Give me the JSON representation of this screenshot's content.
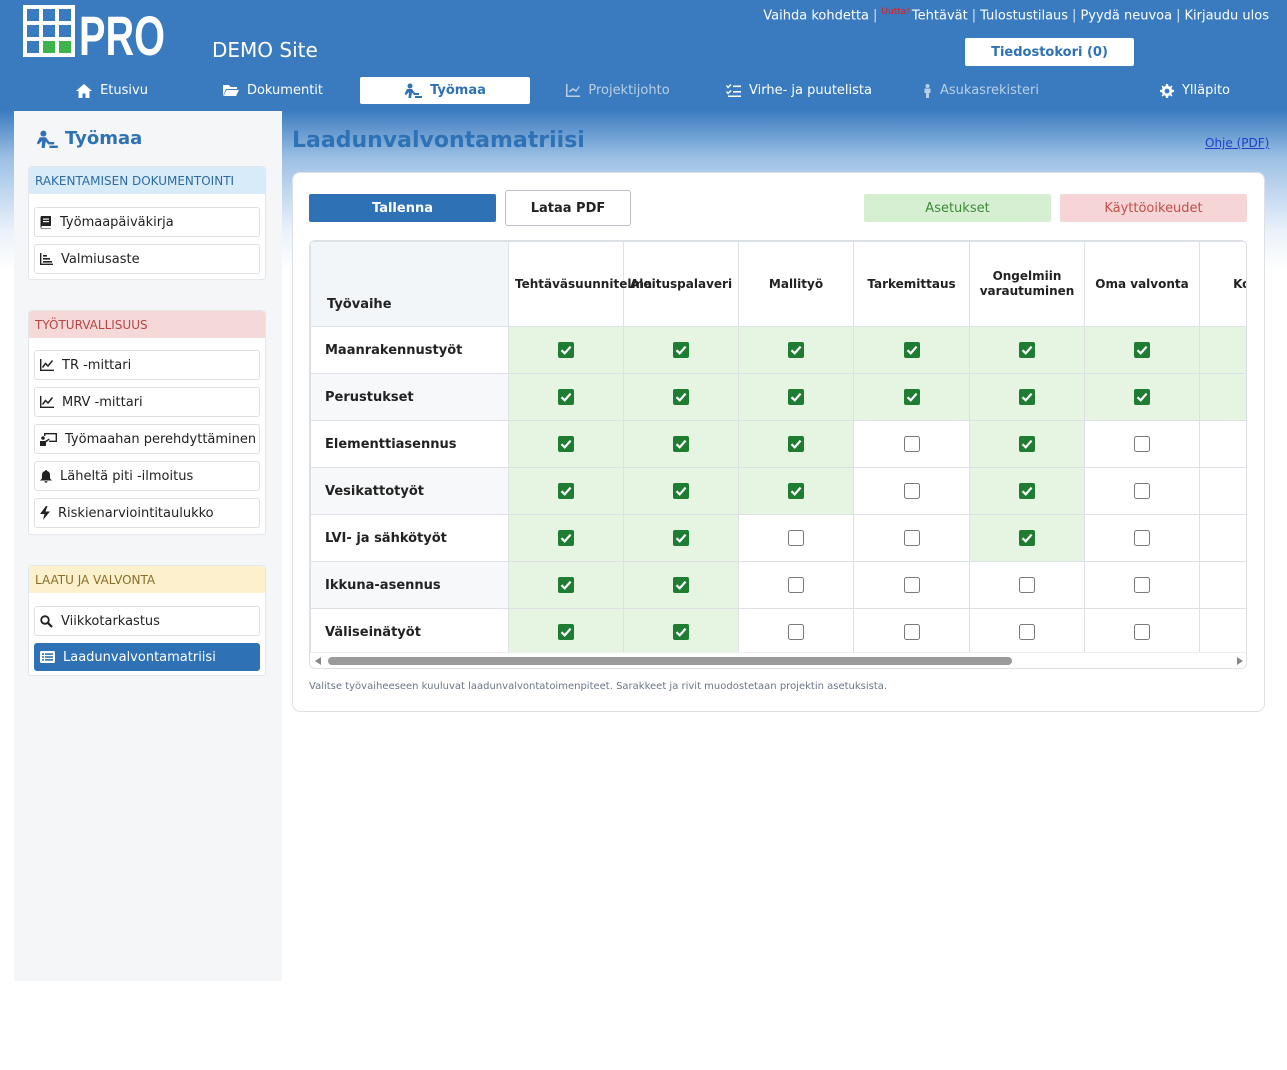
{
  "brand": {
    "logo_text": "PRO",
    "site_name": "DEMO Site"
  },
  "toplinks": [
    {
      "label": "Vaihda kohdetta"
    },
    {
      "label": "Tehtävät",
      "badge": "Uutta!"
    },
    {
      "label": "Tulostustilaus"
    },
    {
      "label": "Pyydä neuvoa"
    },
    {
      "label": "Kirjaudu ulos"
    }
  ],
  "cart": {
    "label": "Tiedostokori (0)"
  },
  "nav": [
    {
      "label": "Etusivu",
      "icon": "home-icon"
    },
    {
      "label": "Dokumentit",
      "icon": "folder-icon"
    },
    {
      "label": "Työmaa",
      "icon": "worker-icon",
      "active": true
    },
    {
      "label": "Projektijohto",
      "icon": "chart-icon",
      "dim": true
    },
    {
      "label": "Virhe- ja puutelista",
      "icon": "checklist-icon"
    },
    {
      "label": "Asukasrekisteri",
      "icon": "person-icon",
      "dim": true
    },
    {
      "label": "Ylläpito",
      "icon": "gear-icon"
    }
  ],
  "sidebar": {
    "title": "Työmaa",
    "groups": [
      {
        "heading": "RAKENTAMISEN DOKUMENTOINTI",
        "items": [
          {
            "label": "Työmaapäiväkirja",
            "icon": "book-icon"
          },
          {
            "label": "Valmiusaste",
            "icon": "bar-chart-icon"
          }
        ]
      },
      {
        "heading": "TYÖTURVALLISUUS",
        "items": [
          {
            "label": "TR -mittari",
            "icon": "line-chart-icon"
          },
          {
            "label": "MRV -mittari",
            "icon": "line-chart-icon"
          },
          {
            "label": "Työmaahan perehdyttäminen",
            "icon": "presentation-icon"
          },
          {
            "label": "Läheltä piti -ilmoitus",
            "icon": "bell-icon"
          },
          {
            "label": "Riskienarviointitaulukko",
            "icon": "bolt-icon"
          }
        ]
      },
      {
        "heading": "LAATU JA VALVONTA",
        "items": [
          {
            "label": "Viikkotarkastus",
            "icon": "search-icon"
          },
          {
            "label": "Laadunvalvontamatriisi",
            "icon": "list-icon",
            "active": true
          }
        ]
      }
    ]
  },
  "main": {
    "title": "Laadunvalvontamatriisi",
    "help_link": "Ohje (PDF)",
    "buttons": {
      "save": "Tallenna",
      "pdf": "Lataa PDF",
      "settings": "Asetukset",
      "rights": "Käyttöoikeudet"
    },
    "hint": "Valitse työvaiheeseen kuuluvat laadunvalvontatoimenpiteet. Sarakkeet ja rivit muodostetaan projektin asetuksista."
  },
  "matrix": {
    "corner_label": "Työvaihe",
    "columns": [
      "Tehtäväsuunnitelma",
      "Aloituspalaveri",
      "Mallityö",
      "Tarkemittaus",
      "Ongelmiin varautuminen",
      "Oma valvonta",
      "Ko mit"
    ],
    "rows": [
      {
        "label": "Maanrakennustyöt",
        "checks": [
          true,
          true,
          true,
          true,
          true,
          true,
          null
        ],
        "tints": [
          1,
          1,
          1,
          1,
          1,
          1,
          1
        ]
      },
      {
        "label": "Perustukset",
        "checks": [
          true,
          true,
          true,
          true,
          true,
          true,
          null
        ],
        "tints": [
          1,
          1,
          1,
          1,
          1,
          1,
          1
        ]
      },
      {
        "label": "Elementtiasennus",
        "checks": [
          true,
          true,
          true,
          false,
          true,
          false,
          null
        ],
        "tints": [
          1,
          1,
          1,
          0,
          1,
          0,
          0
        ]
      },
      {
        "label": "Vesikattotyöt",
        "checks": [
          true,
          true,
          true,
          false,
          true,
          false,
          null
        ],
        "tints": [
          1,
          1,
          1,
          0,
          1,
          0,
          0
        ]
      },
      {
        "label": "LVI- ja sähkötyöt",
        "checks": [
          true,
          true,
          false,
          false,
          true,
          false,
          null
        ],
        "tints": [
          1,
          1,
          0,
          0,
          1,
          0,
          0
        ]
      },
      {
        "label": "Ikkuna-asennus",
        "checks": [
          true,
          true,
          false,
          false,
          false,
          false,
          null
        ],
        "tints": [
          1,
          1,
          0,
          0,
          0,
          0,
          0
        ]
      },
      {
        "label": "Väliseinätyöt",
        "checks": [
          true,
          true,
          false,
          false,
          false,
          false,
          null
        ],
        "tints": [
          1,
          1,
          0,
          0,
          0,
          0,
          0
        ]
      }
    ]
  },
  "colors": {
    "brand_blue": "#3a7bbf",
    "check_green": "#1e7d32",
    "tint_green": "#e6f4e2"
  }
}
